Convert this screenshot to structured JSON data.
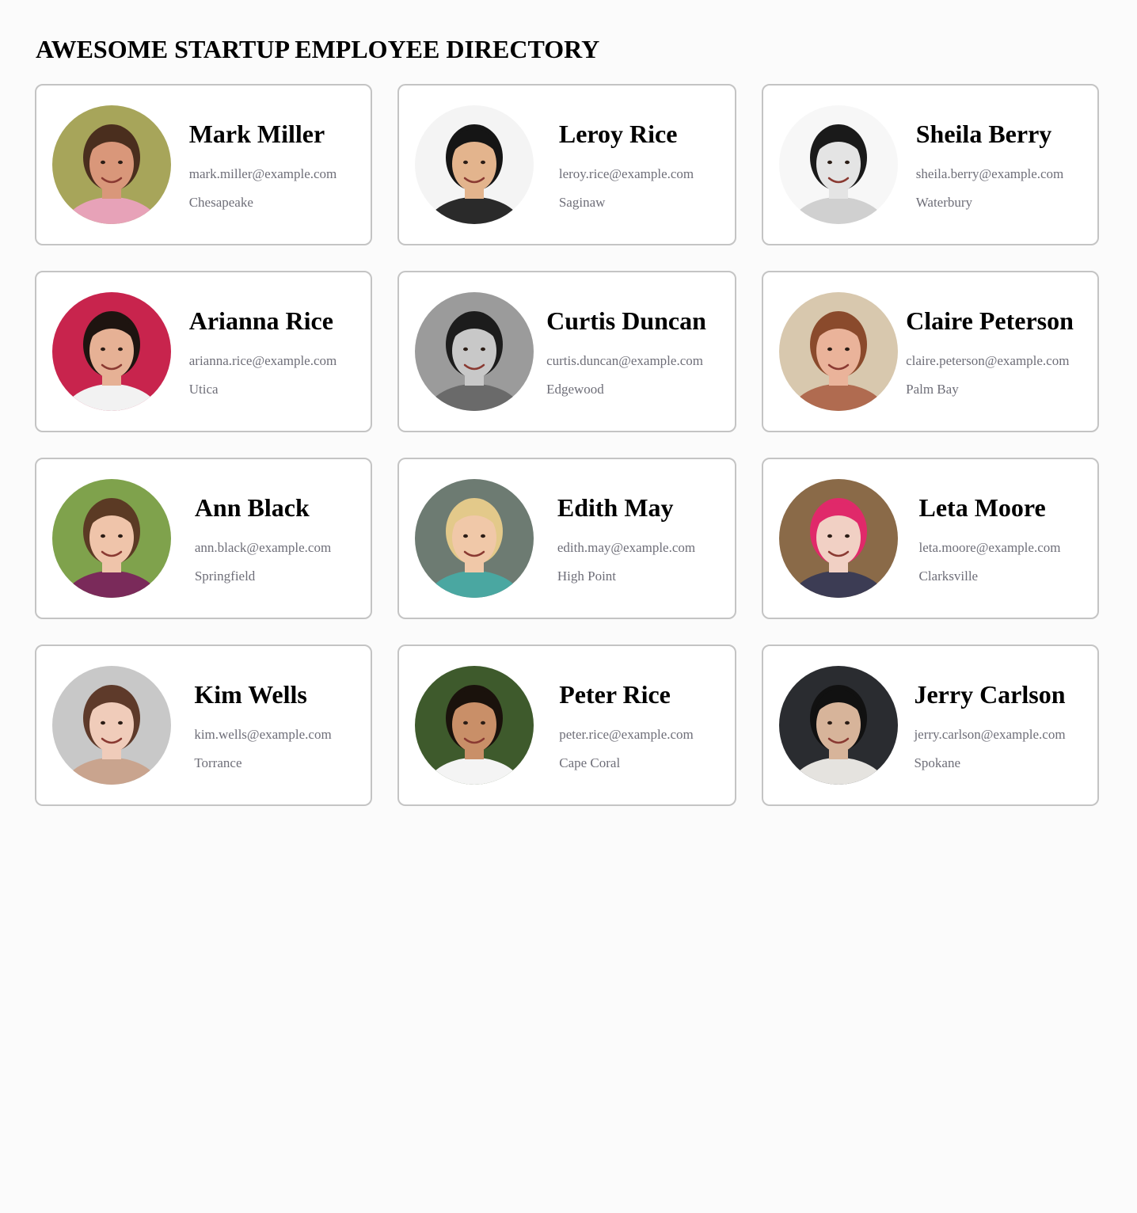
{
  "header": {
    "title": "AWESOME STARTUP EMPLOYEE DIRECTORY"
  },
  "employees": [
    {
      "name": "Mark Miller",
      "email": "mark.miller@example.com",
      "city": "Chesapeake",
      "avatar_icon": "portrait-photo-icon",
      "colors": {
        "bg": "#a7a55a",
        "skin": "#d9977a",
        "hair": "#4a2e1e",
        "shirt": "#e7a2b8"
      }
    },
    {
      "name": "Leroy Rice",
      "email": "leroy.rice@example.com",
      "city": "Saginaw",
      "avatar_icon": "portrait-photo-icon",
      "colors": {
        "bg": "#f4f4f4",
        "skin": "#e3b48d",
        "hair": "#151515",
        "shirt": "#2a2a2a"
      }
    },
    {
      "name": "Sheila Berry",
      "email": "sheila.berry@example.com",
      "city": "Waterbury",
      "avatar_icon": "portrait-photo-icon",
      "colors": {
        "bg": "#f7f7f7",
        "skin": "#e4e4e4",
        "hair": "#1a1a1a",
        "shirt": "#d0d0d0"
      }
    },
    {
      "name": "Arianna Rice",
      "email": "arianna.rice@example.com",
      "city": "Utica",
      "avatar_icon": "portrait-photo-icon",
      "colors": {
        "bg": "#c8244d",
        "skin": "#e6b195",
        "hair": "#1e1410",
        "shirt": "#f2f2f2"
      }
    },
    {
      "name": "Curtis Duncan",
      "email": "curtis.duncan@example.com",
      "city": "Edgewood",
      "avatar_icon": "portrait-photo-icon",
      "colors": {
        "bg": "#9b9b9b",
        "skin": "#c8c8c8",
        "hair": "#1c1c1c",
        "shirt": "#6a6a6a"
      }
    },
    {
      "name": "Claire Peterson",
      "email": "claire.peterson@example.com",
      "city": "Palm Bay",
      "avatar_icon": "portrait-photo-icon",
      "colors": {
        "bg": "#d8c8ae",
        "skin": "#eab39a",
        "hair": "#8a4a2c",
        "shirt": "#b06b50"
      }
    },
    {
      "name": "Ann Black",
      "email": "ann.black@example.com",
      "city": "Springfield",
      "avatar_icon": "portrait-photo-icon",
      "colors": {
        "bg": "#7fa24c",
        "skin": "#efc4aa",
        "hair": "#5b3a24",
        "shirt": "#7a2a5a"
      }
    },
    {
      "name": "Edith May",
      "email": "edith.may@example.com",
      "city": "High Point",
      "avatar_icon": "portrait-photo-icon",
      "colors": {
        "bg": "#6d7b72",
        "skin": "#f0c8a8",
        "hair": "#e3c98a",
        "shirt": "#4aa7a1"
      }
    },
    {
      "name": "Leta Moore",
      "email": "leta.moore@example.com",
      "city": "Clarksville",
      "avatar_icon": "portrait-photo-icon",
      "colors": {
        "bg": "#8a6a48",
        "skin": "#f1d0c4",
        "hair": "#e0296a",
        "shirt": "#3c3c54"
      }
    },
    {
      "name": "Kim Wells",
      "email": "kim.wells@example.com",
      "city": "Torrance",
      "avatar_icon": "portrait-photo-icon",
      "colors": {
        "bg": "#c8c8c8",
        "skin": "#f0ccba",
        "hair": "#5e3a2a",
        "shirt": "#c9a48e"
      }
    },
    {
      "name": "Peter Rice",
      "email": "peter.rice@example.com",
      "city": "Cape Coral",
      "avatar_icon": "portrait-photo-icon",
      "colors": {
        "bg": "#3e5a2c",
        "skin": "#c98f68",
        "hair": "#1a120c",
        "shirt": "#f4f4f4"
      }
    },
    {
      "name": "Jerry Carlson",
      "email": "jerry.carlson@example.com",
      "city": "Spokane",
      "avatar_icon": "portrait-photo-icon",
      "colors": {
        "bg": "#2a2c30",
        "skin": "#d7b49a",
        "hair": "#111111",
        "shirt": "#e5e3df"
      }
    }
  ]
}
